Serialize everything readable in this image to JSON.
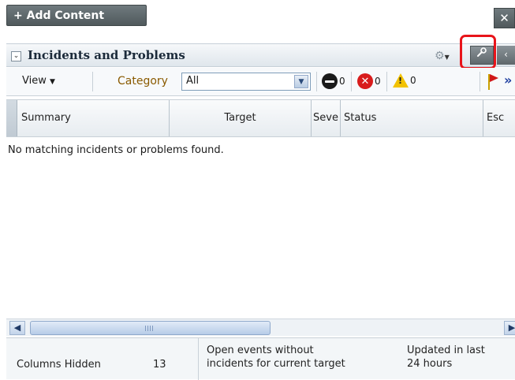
{
  "top": {
    "add_label": "+ Add Content",
    "close_glyph": "✕"
  },
  "panel": {
    "title": "Incidents and Problems",
    "collapse_glyph": "⌄",
    "gear_glyph": "⚙",
    "wrench_glyph": "🔧",
    "right_glyph": "‹"
  },
  "toolbar": {
    "view_label": "View",
    "category_label": "Category",
    "category_value": "All",
    "counts": {
      "fatal": "0",
      "critical": "0",
      "warning": "0"
    },
    "more_glyph": "»"
  },
  "table": {
    "columns": [
      "Summary",
      "Target",
      "Seve",
      "Status",
      "Esc"
    ],
    "empty_message": "No matching incidents or problems found."
  },
  "scrollbar": {
    "left_glyph": "◀",
    "right_glyph": "▶"
  },
  "footer": {
    "columns_hidden_label": "Columns Hidden",
    "columns_hidden_count": "13",
    "open_events_line1": "Open events without",
    "open_events_line2": "incidents for current target",
    "updated_line1": "Updated in last",
    "updated_line2": "24 hours"
  },
  "colors": {
    "highlight": "#e8141a",
    "category_label": "#8a5a00",
    "button_dark": "#50595c"
  }
}
